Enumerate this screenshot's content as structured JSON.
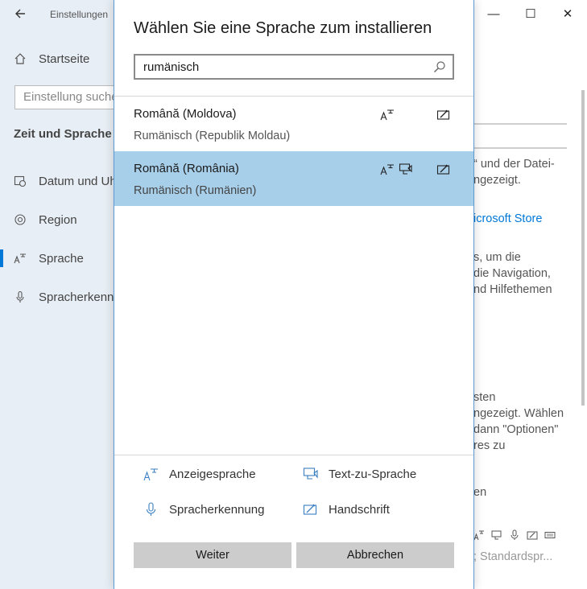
{
  "background": {
    "app_title": "Einstellungen",
    "back_icon": "back-arrow-icon",
    "home_label": "Startseite",
    "search_placeholder": "Einstellung suchen",
    "section_title": "Zeit und Sprache",
    "nav": [
      {
        "label": "Datum und Uhrzeit",
        "icon": "clock-calendar-icon"
      },
      {
        "label": "Region",
        "icon": "globe-icon"
      },
      {
        "label": "Sprache",
        "icon": "language-icon"
      },
      {
        "label": "Spracherkennung",
        "icon": "microphone-icon"
      }
    ],
    "window_controls": {
      "minimize": "—",
      "maximize": "☐",
      "close": "✕"
    },
    "right_texts": [
      "“ und der Datei-",
      "ngezeigt.",
      "icrosoft Store",
      "s, um die",
      "die Navigation,",
      "nd Hilfethemen",
      "sten",
      "ngezeigt. Wählen",
      " dann \"Optionen\"",
      "res zu",
      "en",
      "; Standardspr..."
    ],
    "accent_color": "#0078d7"
  },
  "dialog": {
    "title": "Wählen Sie eine Sprache zum installieren",
    "search_value": "rumänisch",
    "languages": [
      {
        "name": "Română (Moldova)",
        "subtitle": "Rumänisch (Republik Moldau)",
        "selected": false,
        "features": [
          "display-language",
          "handwriting"
        ]
      },
      {
        "name": "Română (România)",
        "subtitle": "Rumänisch (Rumänien)",
        "selected": true,
        "features": [
          "display-language",
          "text-to-speech",
          "handwriting"
        ]
      }
    ],
    "legend": {
      "display_language": "Anzeigesprache",
      "text_to_speech": "Text-zu-Sprache",
      "speech_recognition": "Spracherkennung",
      "handwriting": "Handschrift"
    },
    "buttons": {
      "next": "Weiter",
      "cancel": "Abbrechen"
    },
    "selection_color": "#a8cfea"
  }
}
